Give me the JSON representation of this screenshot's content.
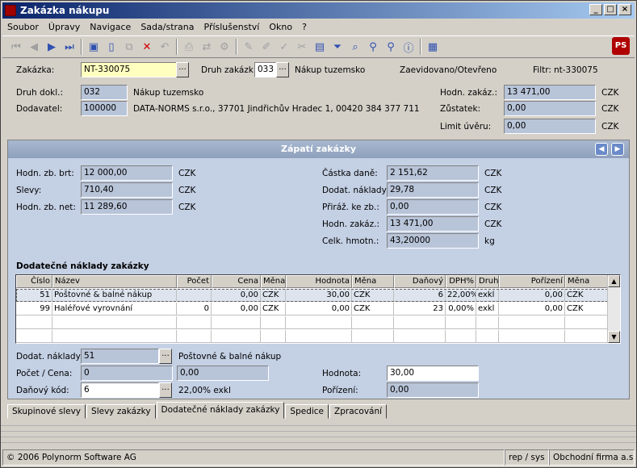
{
  "window": {
    "title": "Zakázka nákupu"
  },
  "menu": [
    "Soubor",
    "Úpravy",
    "Navigace",
    "Sada/strana",
    "Příslušenství",
    "Okno",
    "?"
  ],
  "header": {
    "zakazka_label": "Zakázka:",
    "zakazka_value": "NT-330075",
    "druh_zakazk_label": "Druh zakázk:",
    "druh_zakazk_value": "033",
    "druh_zakazk_text": "Nákup tuzemsko",
    "stav": "Zaevidovano/Otevřeno",
    "filtr_label": "Filtr:",
    "filtr_value": "nt-330075",
    "druh_dokl_label": "Druh dokl.:",
    "druh_dokl_value": "032",
    "druh_dokl_text": "Nákup tuzemsko",
    "dodavatel_label": "Dodavatel:",
    "dodavatel_value": "100000",
    "dodavatel_text": "DATA-NORMS s.r.o., 37701 Jindřichův Hradec 1, 00420 384 377 711",
    "hodn_zakaz_label": "Hodn. zakáz.:",
    "hodn_zakaz_value": "13 471,00",
    "zustatek_label": "Zůstatek:",
    "zustatek_value": "0,00",
    "limit_label": "Limit úvěru:",
    "limit_value": "0,00",
    "currency": "CZK"
  },
  "footer_panel": {
    "title": "Zápatí zakázky",
    "hodn_brt_label": "Hodn. zb. brt:",
    "hodn_brt_value": "12 000,00",
    "slevy_label": "Slevy:",
    "slevy_value": "710,40",
    "hodn_net_label": "Hodn. zb. net:",
    "hodn_net_value": "11 289,60",
    "castka_dane_label": "Částka daně:",
    "castka_dane_value": "2 151,62",
    "dodat_naklady_label": "Dodat. náklady:",
    "dodat_naklady_value": "29,78",
    "priraz_label": "Přiráž. ke zb.:",
    "priraz_value": "0,00",
    "hodn_zakaz_label": "Hodn. zakáz.:",
    "hodn_zakaz_value": "13 471,00",
    "hmotn_label": "Celk. hmotn.:",
    "hmotn_value": "43,20000",
    "hmotn_unit": "kg",
    "currency": "CZK"
  },
  "costs": {
    "heading": "Dodatečné náklady zakázky",
    "columns": [
      "Číslo",
      "Název",
      "Počet",
      "Cena",
      "Měna",
      "Hodnota",
      "Měna",
      "Daňový kód",
      "DPH%",
      "Druh",
      "Pořízení",
      "Měna"
    ],
    "rows": [
      [
        "51",
        "Poštovné & balné nákup",
        "",
        "0,00",
        "CZK",
        "30,00",
        "CZK",
        "6",
        "22,00%",
        "exkl",
        "0,00",
        "CZK"
      ],
      [
        "99",
        "Haléřové vyrovnání",
        "0",
        "0,00",
        "CZK",
        "0,00",
        "CZK",
        "23",
        "0,00%",
        "exkl",
        "0,00",
        "CZK"
      ]
    ]
  },
  "detail": {
    "dodat_label": "Dodat. náklady:",
    "dodat_value": "51",
    "dodat_text": "Poštovné & balné nákup",
    "pocet_label": "Počet / Cena:",
    "pocet_value": "0",
    "cena_value": "0,00",
    "dan_label": "Daňový kód:",
    "dan_value": "6",
    "dan_text": "22,00% exkl",
    "hodnota_label": "Hodnota:",
    "hodnota_value": "30,00",
    "porizeni_label": "Pořízení:",
    "porizeni_value": "0,00"
  },
  "tabs": [
    "Skupinové slevy",
    "Slevy zakázky",
    "Dodatečné náklady zakázky",
    "Spedice",
    "Zpracování"
  ],
  "status": {
    "copyright": "© 2006 Polynorm Software AG",
    "user": "rep / sys",
    "company": "Obchodní firma a.s."
  }
}
